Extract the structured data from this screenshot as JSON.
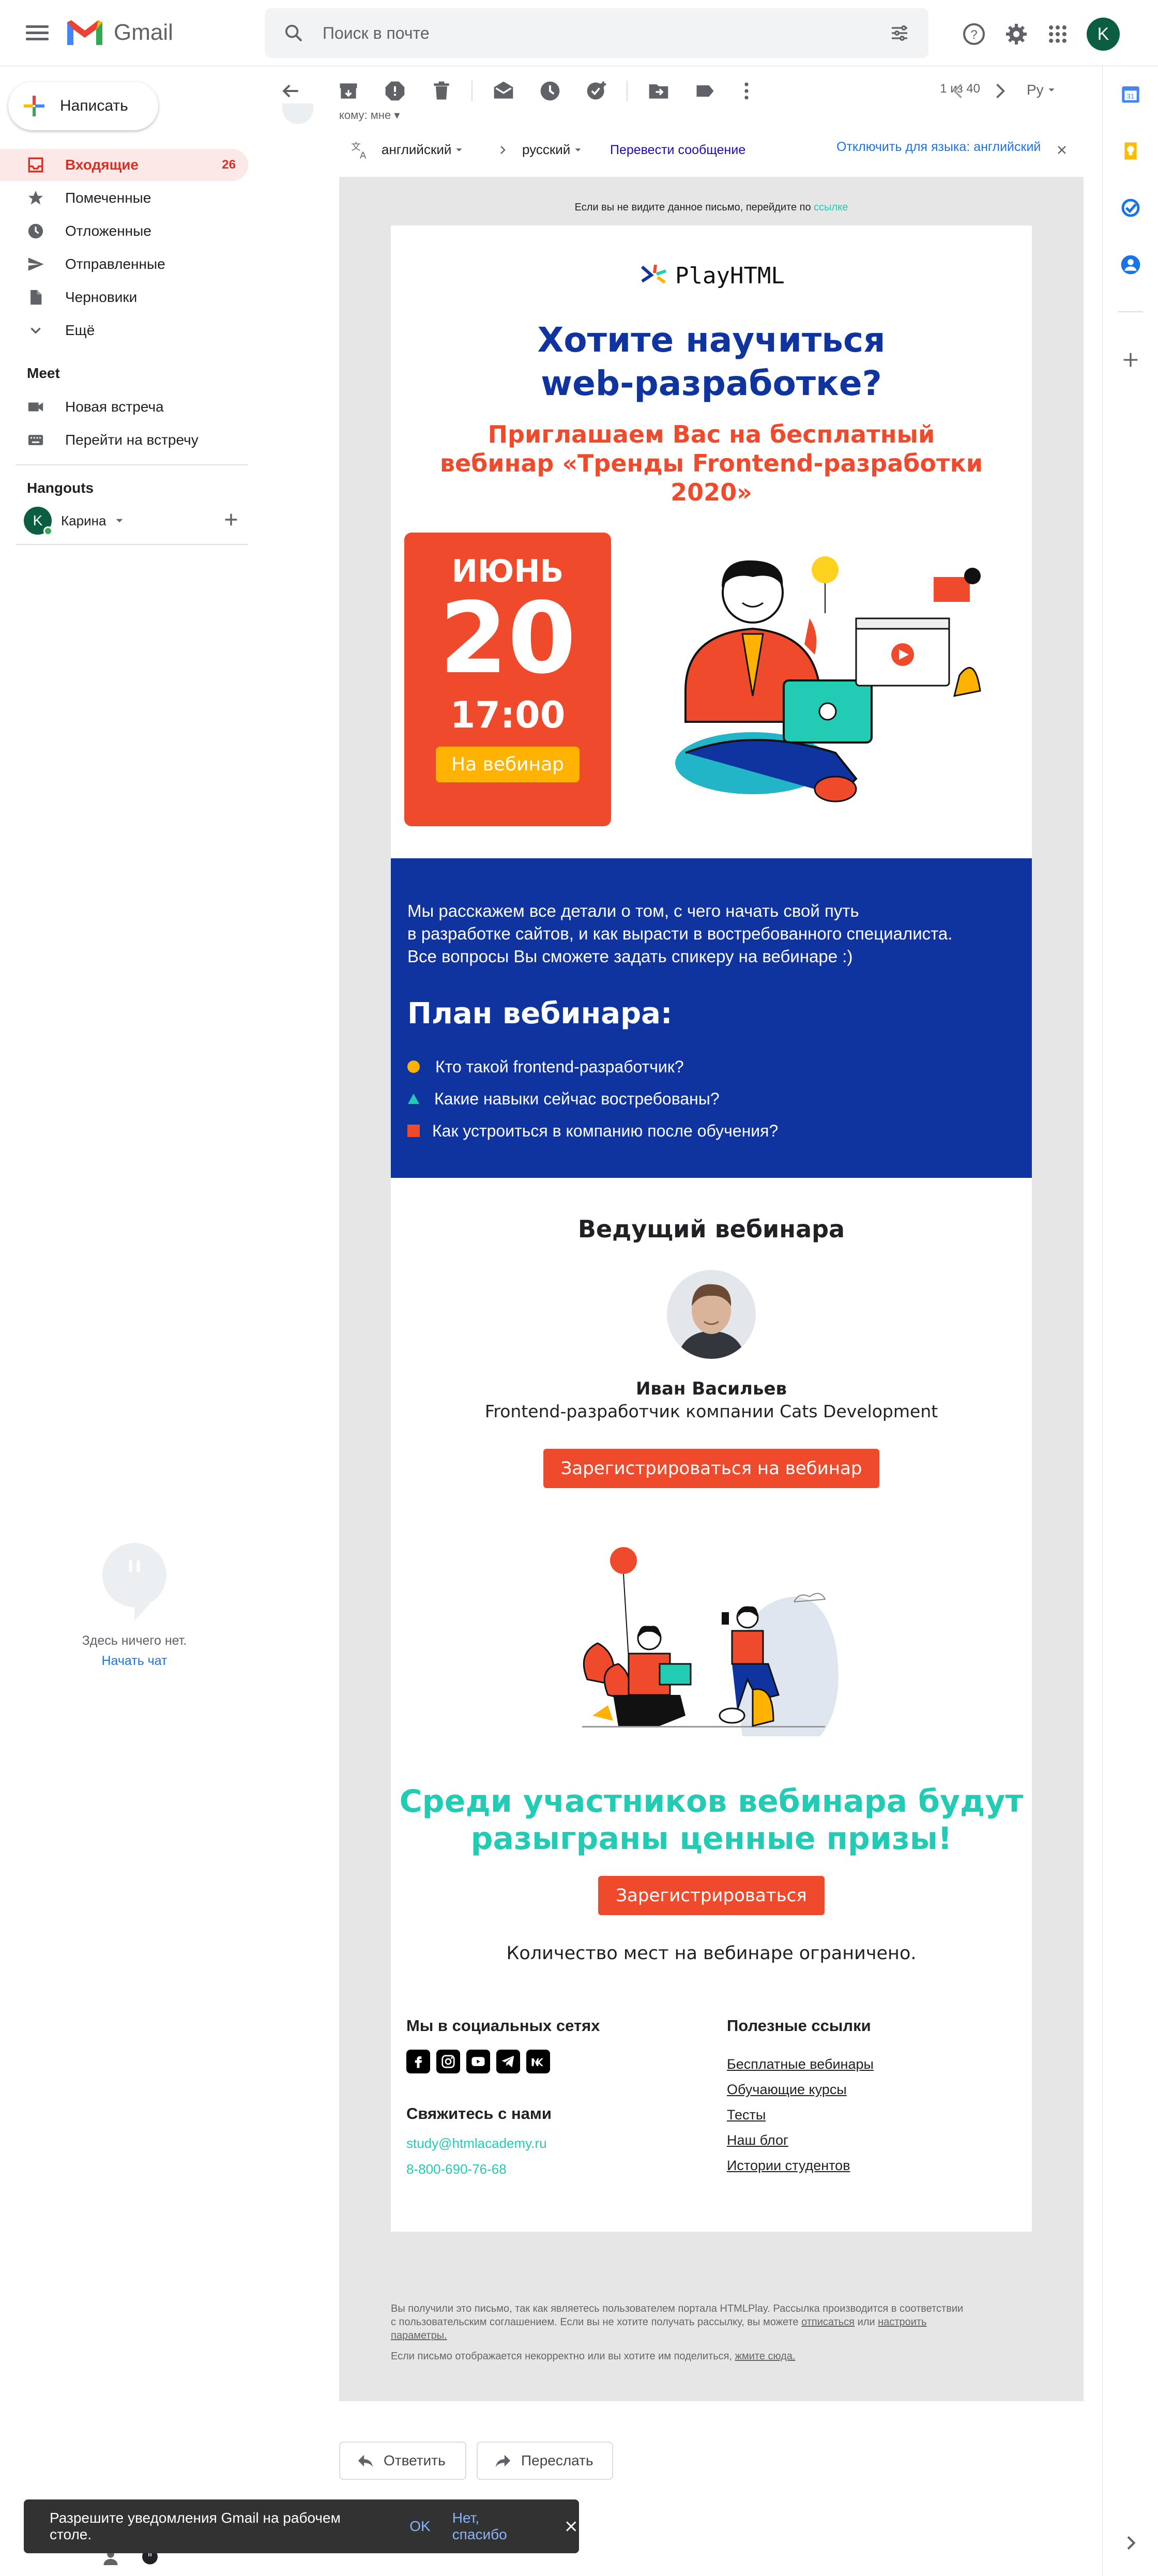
{
  "app": {
    "name": "Gmail"
  },
  "search": {
    "placeholder": "Поиск в почте"
  },
  "account": {
    "initial": "K"
  },
  "compose": {
    "label": "Написать"
  },
  "nav": [
    {
      "label": "Входящие",
      "count": "26"
    },
    {
      "label": "Помеченные"
    },
    {
      "label": "Отложенные"
    },
    {
      "label": "Отправленные"
    },
    {
      "label": "Черновики"
    },
    {
      "label": "Ещё"
    }
  ],
  "meet": {
    "title": "Meet",
    "items": [
      "Новая встреча",
      "Перейти на встречу"
    ]
  },
  "hangouts": {
    "title": "Hangouts",
    "user": "Карина",
    "user_initial": "K",
    "empty_text": "Здесь ничего нет.",
    "start_chat": "Начать чат"
  },
  "toolbar": {
    "pager": "1 из 40",
    "lang_btn": "Ру"
  },
  "message": {
    "recipient_line": "кому: мне"
  },
  "translate": {
    "from_lang": "английский",
    "to_lang": "русский",
    "translate_link": "Перевести сообщение",
    "disable_link": "Отключить для языка: английский"
  },
  "email": {
    "preheader_text": "Если вы не видите данное письмо, перейдите по",
    "preheader_link": "ссылке",
    "brand": "PlayHTML",
    "headline_1": "Хотите научиться",
    "headline_2": "web-разработке?",
    "subhead_1": "Приглашаем Вас на бесплатный",
    "subhead_2": "вебинар «Тренды Frontend-разработки",
    "subhead_3": "2020»",
    "date_month": "ИЮНЬ",
    "date_day": "20",
    "date_time": "17:00",
    "date_button": "На вебинар",
    "intro_1": "Мы расскажем все детали о том, с чего начать свой путь",
    "intro_2": "в разработке сайтов, и как вырасти в востребованного специалиста.",
    "intro_3": "Все вопросы Вы сможете задать спикеру на вебинаре :)",
    "plan_title": "План вебинара:",
    "plan_items": [
      "Кто такой frontend-разработчик?",
      "Какие навыки сейчас востребованы?",
      "Как устроиться в компанию после обучения?"
    ],
    "host_title": "Ведущий вебинара",
    "host_name": "Иван Васильев",
    "host_role": "Frontend-разработчик компании Cats Development",
    "register_button": "Зарегистрироваться на вебинар",
    "prizes_1": "Среди участников вебинара будут",
    "prizes_2": "разыграны ценные призы!",
    "register_short": "Зарегистрироваться",
    "limited": "Количество мест на вебинаре ограничено.",
    "social_title": "Мы в социальных сетях",
    "contact_title": "Свяжитесь с нами",
    "contact_email": "study@htmlacademy.ru",
    "contact_phone": "8-800-690-76-68",
    "links_title": "Полезные ссылки",
    "links": [
      "Бесплатные вебинары",
      "Обучающие курсы",
      "Тесты",
      "Наш блог",
      "Истории студентов"
    ],
    "legal_1": "Вы получили это письмо, так как являетесь пользователем портала HTMLPlay. Рассылка производится в соответствии",
    "legal_2a": "с пользовательским соглашением. Если вы не хотите получать рассылку, вы можете",
    "legal_unsub": "отписаться",
    "legal_or": "или",
    "legal_settings": "настроить",
    "legal_params": "параметры.",
    "legal_3": "Если письмо отображается некорректно или вы хотите им поделиться,",
    "legal_link": "жмите сюда."
  },
  "actions": {
    "reply": "Ответить",
    "forward": "Переслать"
  },
  "snackbar": {
    "text": "Разрешите уведомления Gmail на рабочем столе.",
    "ok": "OK",
    "no": "Нет, спасибо"
  },
  "colors": {
    "accent_red": "#f04a2c",
    "brand_blue": "#0f339f",
    "teal": "#22cbb3",
    "gmail_red": "#d93025"
  }
}
